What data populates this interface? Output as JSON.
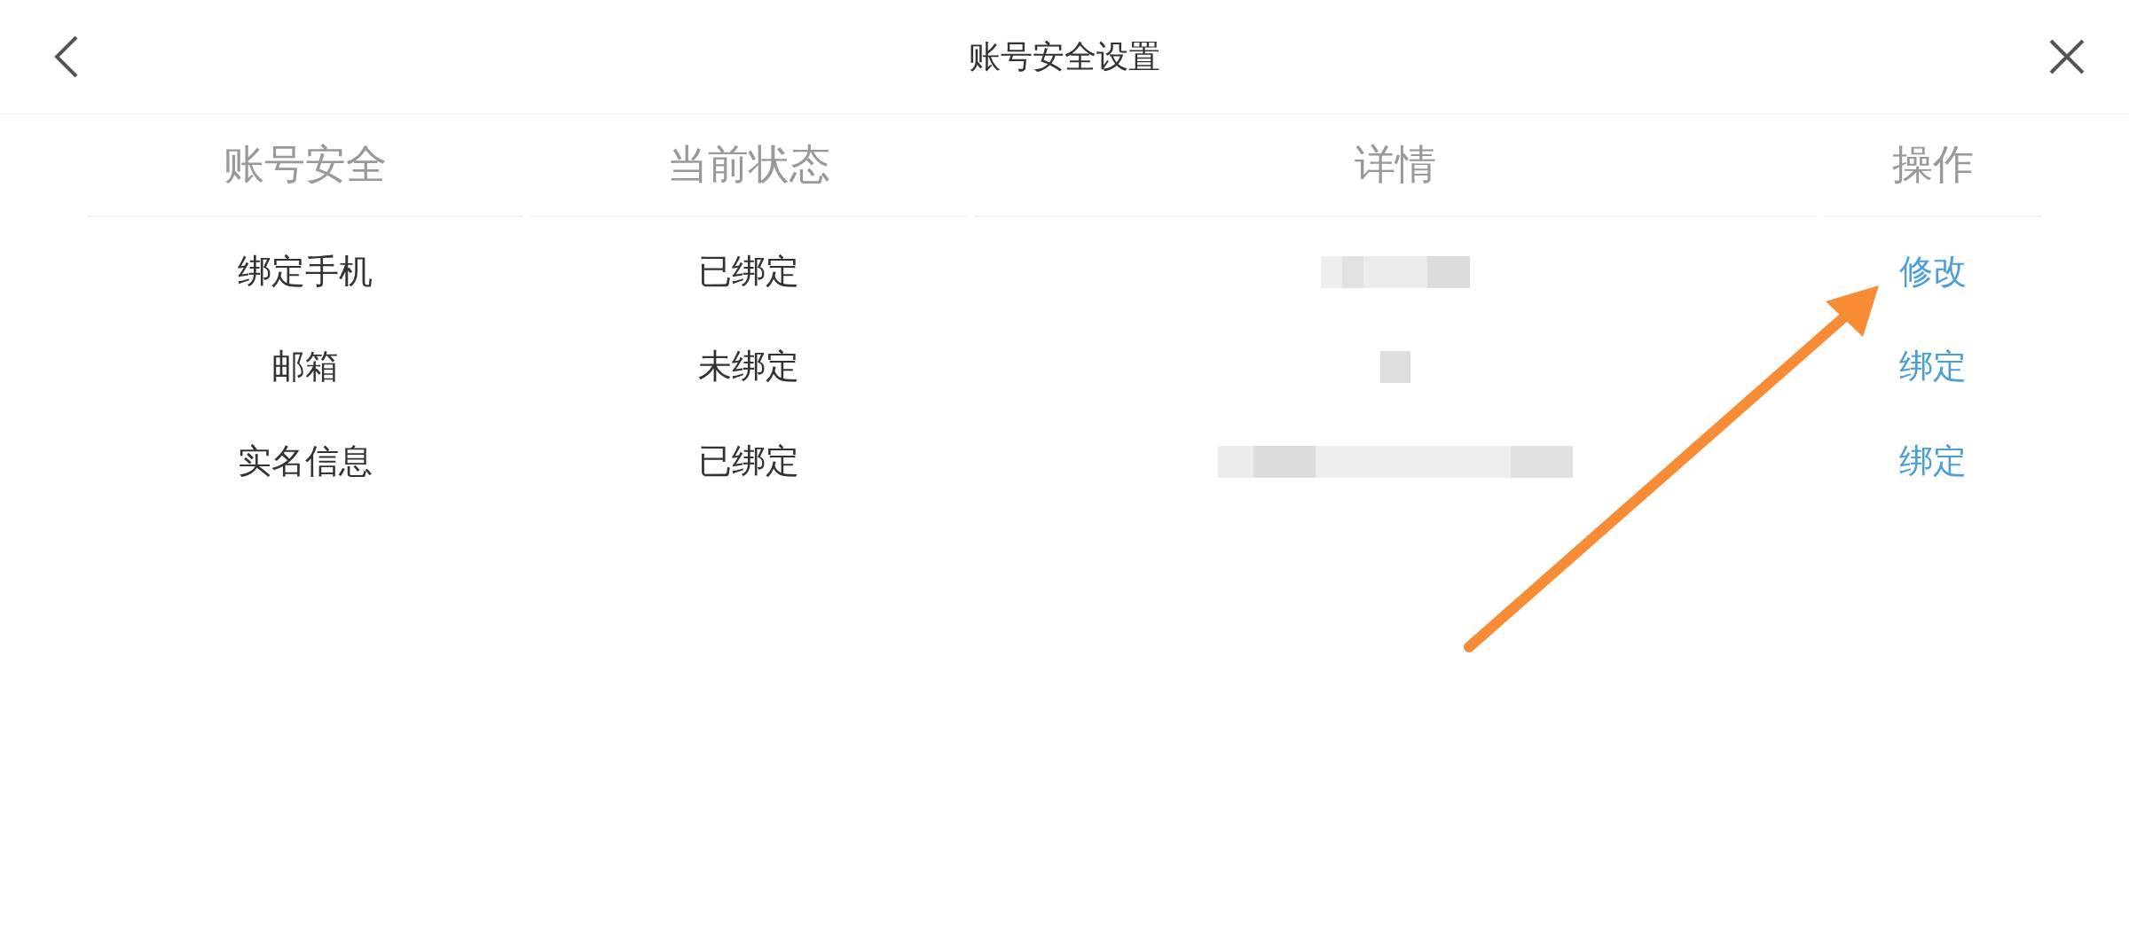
{
  "header": {
    "title": "账号安全设置"
  },
  "table": {
    "columns": [
      "账号安全",
      "当前状态",
      "详情",
      "操作"
    ],
    "rows": [
      {
        "item": "绑定手机",
        "status": "已绑定",
        "action": "修改"
      },
      {
        "item": "邮箱",
        "status": "未绑定",
        "action": "绑定"
      },
      {
        "item": "实名信息",
        "status": "已绑定",
        "action": "绑定"
      }
    ]
  }
}
